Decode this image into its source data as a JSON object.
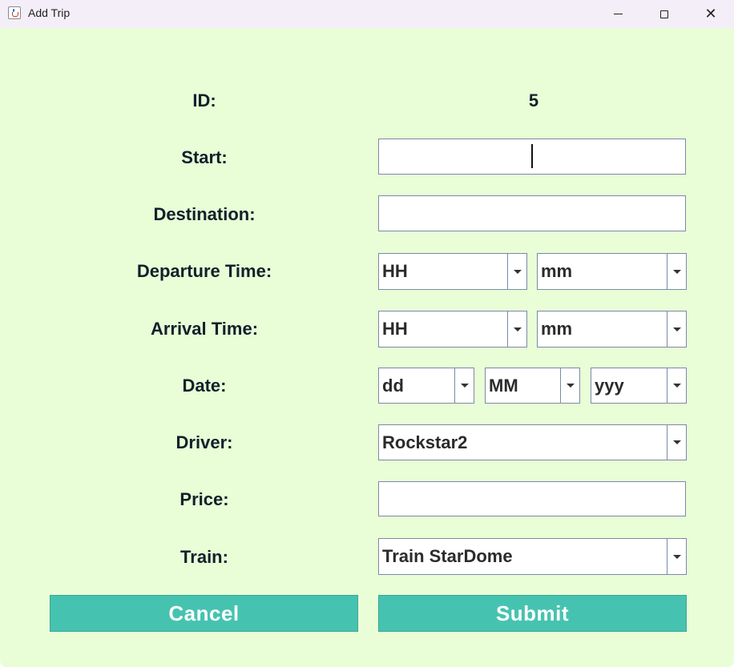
{
  "window": {
    "title": "Add Trip",
    "close_glyph": "✕"
  },
  "form": {
    "id_label": "ID:",
    "id_value": "5",
    "start_label": "Start:",
    "start_value": "",
    "destination_label": "Destination:",
    "destination_value": "",
    "departure_label": "Departure Time:",
    "departure_hour": "HH",
    "departure_minute": "mm",
    "arrival_label": "Arrival Time:",
    "arrival_hour": "HH",
    "arrival_minute": "mm",
    "date_label": "Date:",
    "date_day": "dd",
    "date_month": "MM",
    "date_year": "yyy",
    "driver_label": "Driver:",
    "driver_value": "Rockstar2",
    "price_label": "Price:",
    "price_value": "",
    "train_label": "Train:",
    "train_value": "Train StarDome"
  },
  "buttons": {
    "cancel": "Cancel",
    "submit": "Submit"
  },
  "colors": {
    "background": "#e9fdd7",
    "button": "#46c3b0",
    "titlebar": "#f3eef7"
  },
  "icons": [
    "java-app-icon",
    "minimize-icon",
    "maximize-icon",
    "close-icon",
    "chevron-down-icon"
  ]
}
